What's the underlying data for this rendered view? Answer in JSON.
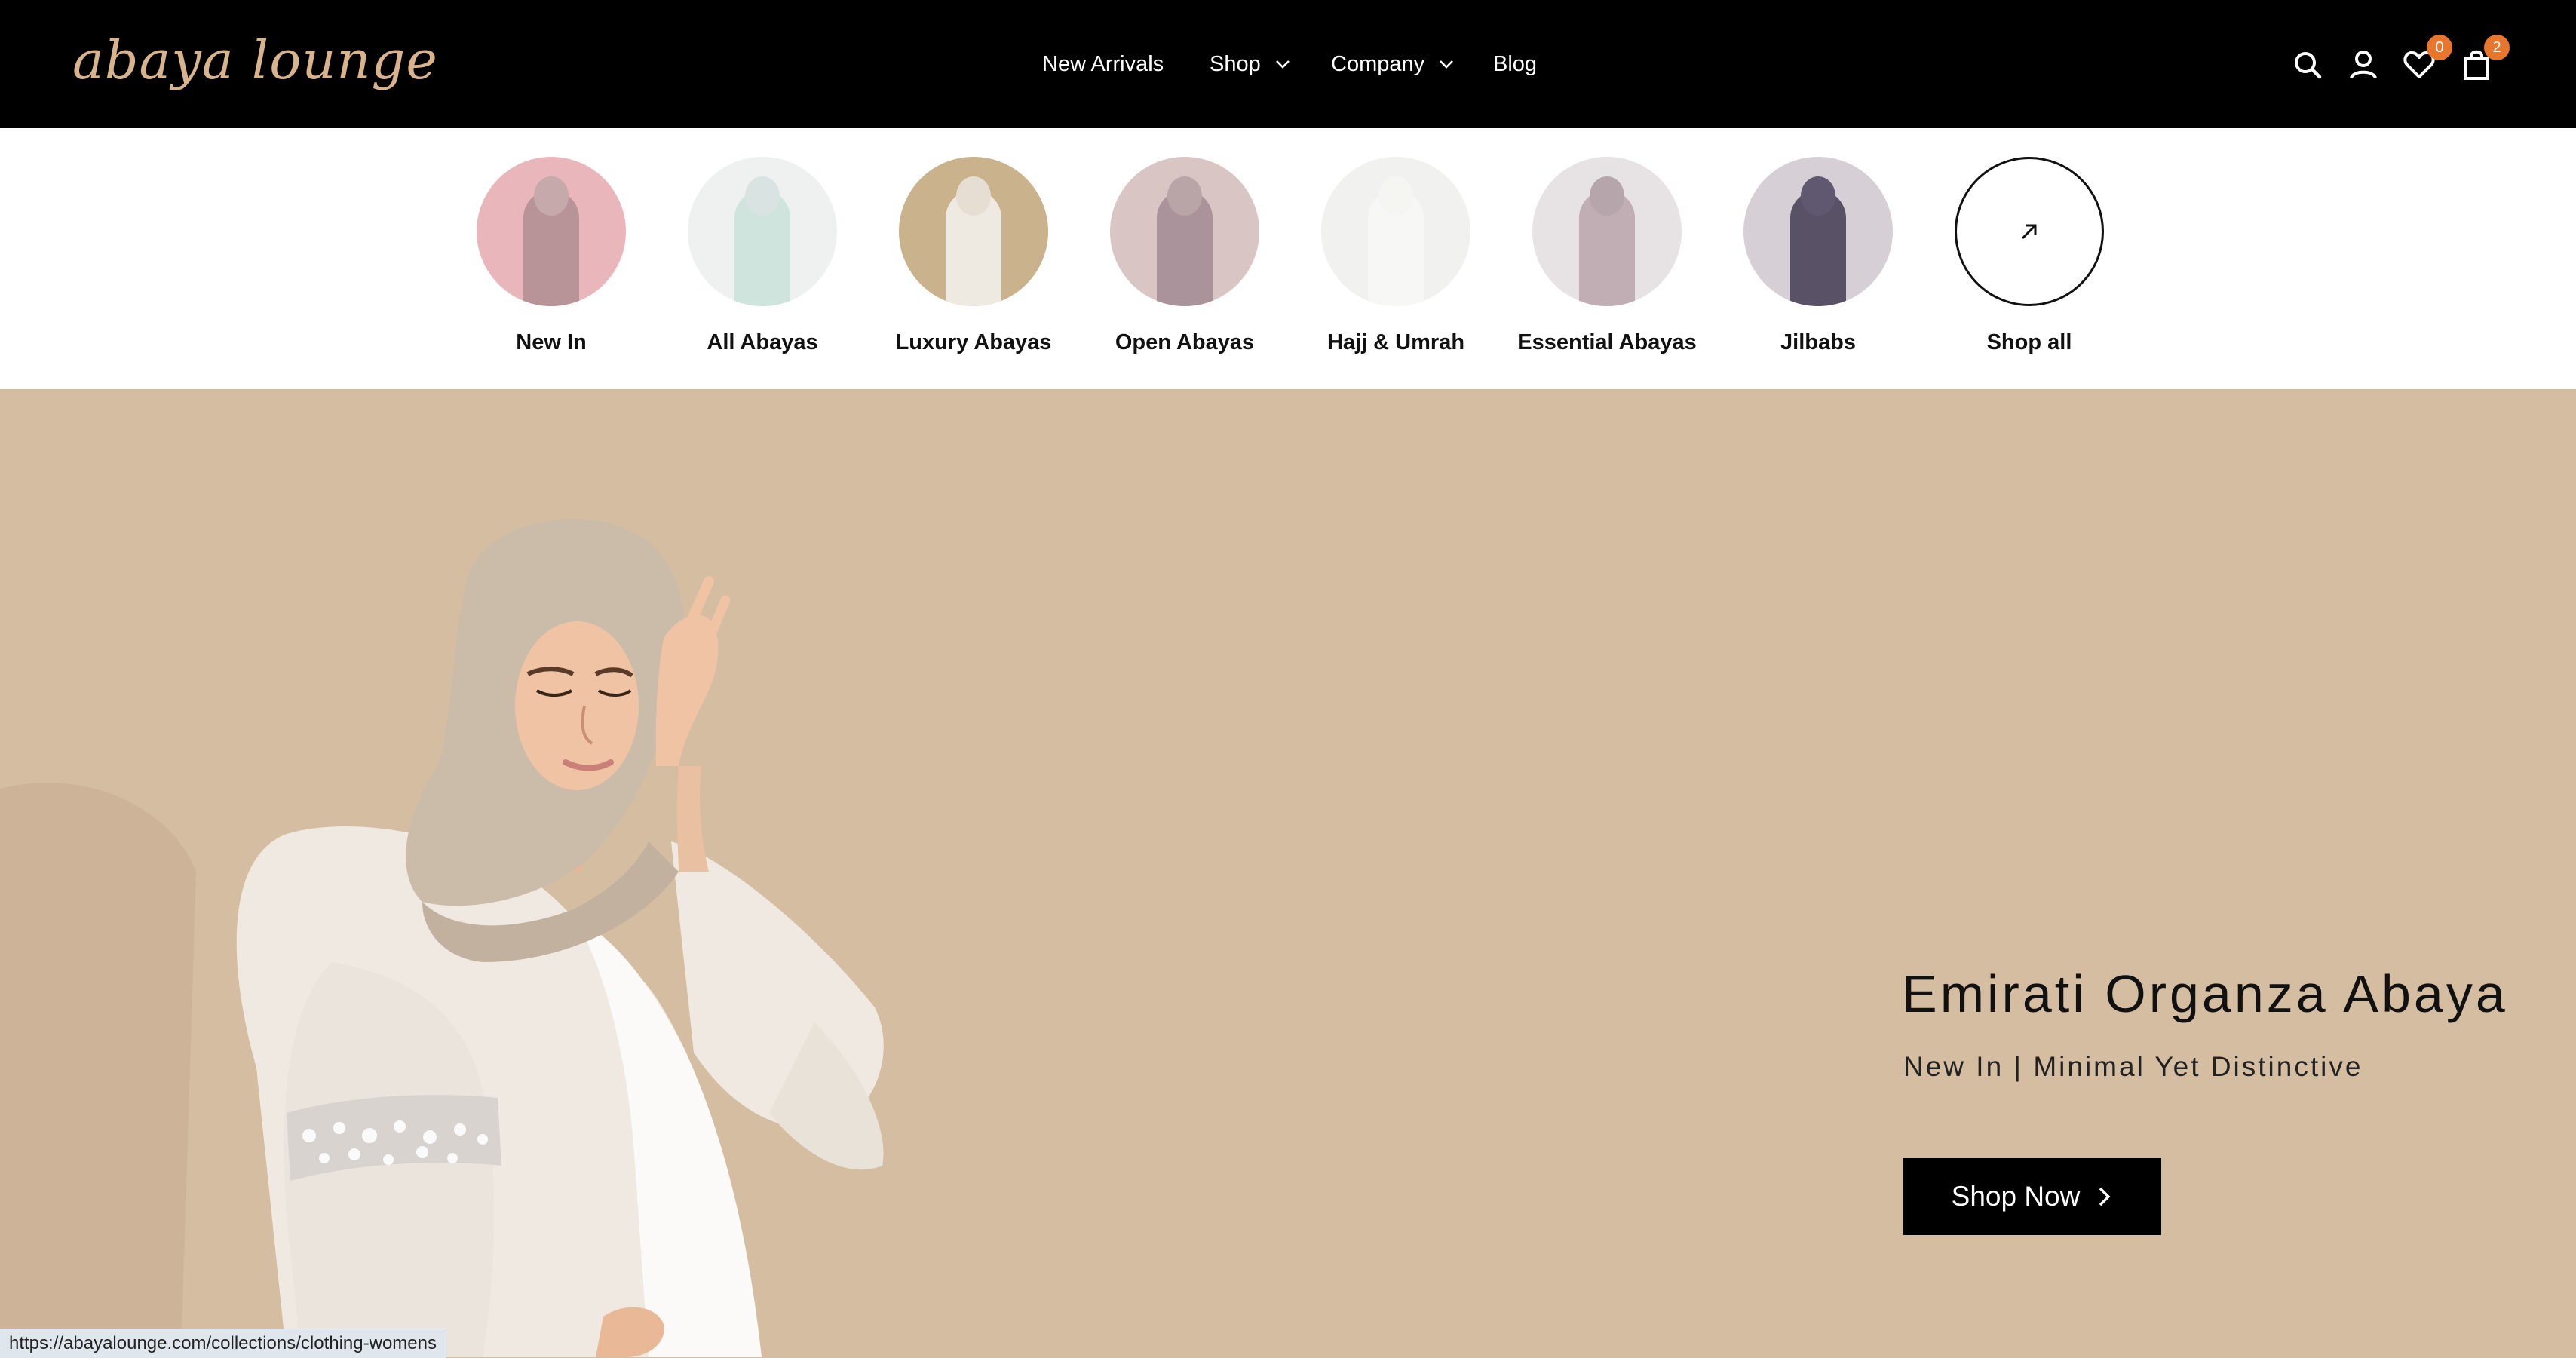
{
  "brand": {
    "logo_text": "abaya lounge"
  },
  "nav": {
    "items": [
      {
        "label": "New Arrivals",
        "has_dropdown": false
      },
      {
        "label": "Shop",
        "has_dropdown": true
      },
      {
        "label": "Company",
        "has_dropdown": true
      },
      {
        "label": "Blog",
        "has_dropdown": false
      }
    ]
  },
  "header_icons": {
    "search": "search-icon",
    "account": "user-icon",
    "wishlist": {
      "icon": "heart-icon",
      "count": "0"
    },
    "cart": {
      "icon": "bag-icon",
      "count": "2"
    }
  },
  "categories": [
    {
      "label": "New In",
      "bg": "#e9b7bb",
      "dress": "#b89499",
      "hijab": "#c5a9ab"
    },
    {
      "label": "All Abayas",
      "bg": "#eef1ef",
      "dress": "#cfe4dd",
      "hijab": "#d9e4e2"
    },
    {
      "label": "Luxury Abayas",
      "bg": "#c9b28c",
      "dress": "#eee9e1",
      "hijab": "#e6ded3"
    },
    {
      "label": "Open Abayas",
      "bg": "#d9c6c4",
      "dress": "#aa939a",
      "hijab": "#b9a4a8"
    },
    {
      "label": "Hajj & Umrah",
      "bg": "#f1f1ef",
      "dress": "#f7f7f5",
      "hijab": "#f5f5f2"
    },
    {
      "label": "Essential Abayas",
      "bg": "#e7e2e3",
      "dress": "#c0aeb4",
      "hijab": "#b6a5ab"
    },
    {
      "label": "Jilbabs",
      "bg": "#d7cfd6",
      "dress": "#595166",
      "hijab": "#5f5870"
    },
    {
      "label": "Shop all",
      "bg": "#ffffff",
      "icon": "arrow-up-right-icon"
    }
  ],
  "hero": {
    "title": "Emirati Organza Abaya",
    "subtitle": "New In | Minimal Yet Distinctive",
    "cta": "Shop Now",
    "bg_color": "#d5bda2"
  },
  "status_bar": {
    "url": "https://abayalounge.com/collections/clothing-womens"
  }
}
